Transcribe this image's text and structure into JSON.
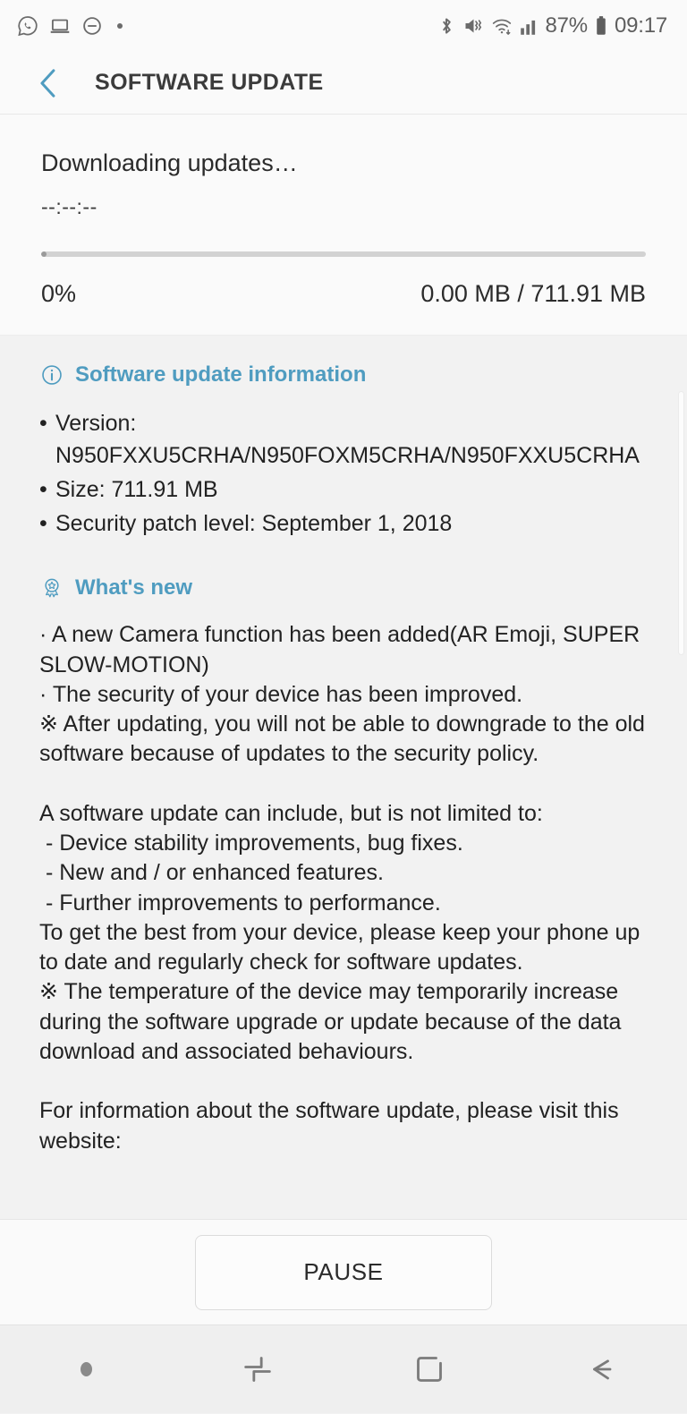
{
  "status_bar": {
    "left_icons": [
      {
        "name": "whatsapp-icon",
        "label": "WhatsApp notification"
      },
      {
        "name": "laptop-icon",
        "label": "Connected device"
      },
      {
        "name": "do-not-disturb-icon",
        "label": "Do not disturb"
      },
      {
        "name": "more-notifications-dot",
        "label": "More notifications"
      }
    ],
    "right_icons": [
      {
        "name": "bluetooth-icon",
        "label": "Bluetooth"
      },
      {
        "name": "mute-vibrate-icon",
        "label": "Sound off / vibrate"
      },
      {
        "name": "wifi-icon",
        "label": "Wi-Fi"
      },
      {
        "name": "cellular-signal-icon",
        "label": "Cellular signal"
      }
    ],
    "battery_percent": "87%",
    "time": "09:17"
  },
  "app_bar": {
    "title": "SOFTWARE UPDATE",
    "back_icon": "back-chevron-icon",
    "accent_color": "#4f9cc0"
  },
  "progress": {
    "status_label": "Downloading updates…",
    "time_remaining": "--:--:--",
    "percent_label": "0%",
    "percent_value": 0,
    "size_label": "0.00 MB / 711.91 MB",
    "downloaded": "0.00 MB",
    "total": "711.91 MB"
  },
  "update_info": {
    "heading": "Software update information",
    "heading_icon": "info-circle-icon",
    "items": [
      "Version: N950FXXU5CRHA/N950FOXM5CRHA/N950FXXU5CRHA",
      "Size: 711.91 MB",
      "Security patch level: September 1, 2018"
    ]
  },
  "whats_new": {
    "heading": "What's new",
    "heading_icon": "award-badge-icon",
    "body": "· A new Camera function has been added(AR Emoji, SUPER SLOW-MOTION)\n· The security of your device has been improved.\n※ After updating, you will not be able to downgrade to the old software because of updates to the security policy.\n\nA software update can include, but is not limited to:\n - Device stability improvements, bug fixes.\n - New and / or enhanced features.\n - Further improvements to performance.\nTo get the best from your device, please keep your phone up to date and regularly check for software updates.\n※ The temperature of the device may temporarily increase during the software upgrade or update because of the data download and associated behaviours.\n\nFor information about the software update, please visit this website:"
  },
  "actions": {
    "pause_label": "PAUSE"
  },
  "nav_bar": {
    "items": [
      {
        "name": "nav-dot-indicator",
        "label": "Notification dot"
      },
      {
        "name": "recents-icon",
        "label": "Recents"
      },
      {
        "name": "home-icon",
        "label": "Home"
      },
      {
        "name": "back-icon",
        "label": "Back"
      }
    ]
  }
}
